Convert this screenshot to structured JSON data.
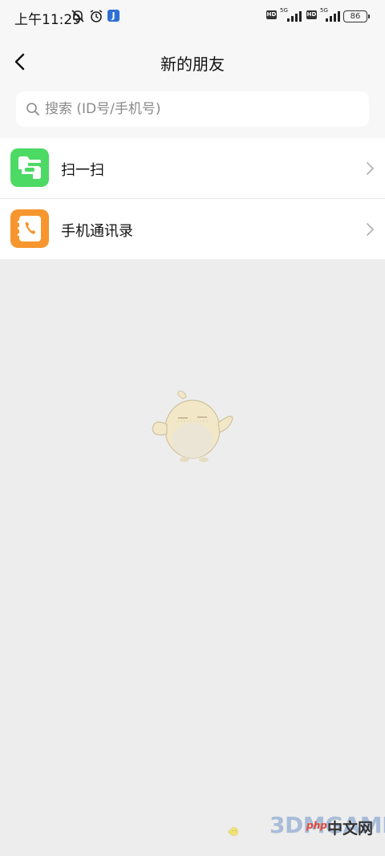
{
  "status_bar": {
    "time": "上午11:29",
    "network_1": "5G",
    "network_2": "5G",
    "hd_1": "HD",
    "hd_2": "HD",
    "battery": "86",
    "app_badge": "J"
  },
  "header": {
    "title": "新的朋友",
    "back_icon": "chevron-left-icon"
  },
  "search": {
    "placeholder": "搜索 (ID号/手机号)",
    "value": ""
  },
  "menu": {
    "items": [
      {
        "label": "扫一扫",
        "icon": "scan-icon",
        "color": "#4cd964"
      },
      {
        "label": "手机通讯录",
        "icon": "phone-contacts-icon",
        "color": "#f7962f"
      }
    ]
  },
  "colors": {
    "page_bg": "#ededed",
    "header_bg": "#f7f7f7"
  },
  "watermark": {
    "brand": "3DMGAME",
    "site_prefix": "php",
    "site_suffix": "中文网"
  }
}
